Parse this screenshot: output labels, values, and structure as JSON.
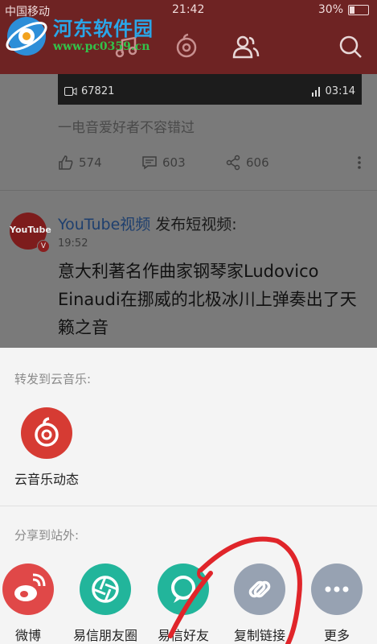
{
  "status_bar": {
    "carrier": "中国移动",
    "time": "21:42",
    "battery": "30%"
  },
  "watermark": {
    "title": "河东软件园",
    "url": "www.pc0359.cn"
  },
  "feed": {
    "video": {
      "views": "67821",
      "duration": "03:14"
    },
    "caption": "一电音爱好者不容错过",
    "actions": {
      "likes": "574",
      "comments": "603",
      "shares": "606"
    },
    "post": {
      "avatar_text": "YouTube",
      "author": "YouTube视频",
      "action_text": " 发布短视频:",
      "time": "19:52",
      "body": "意大利著名作曲家钢琴家Ludovico Einaudi在挪威的北极冰川上弹奏出了天籁之音"
    }
  },
  "share_sheet": {
    "forward_label": "转发到云音乐:",
    "forward_items": [
      {
        "label": "云音乐动态",
        "color": "#d63b33"
      }
    ],
    "external_label": "分享到站外:",
    "external_items": [
      {
        "label": "微博",
        "color": "#e04848"
      },
      {
        "label": "易信朋友圈",
        "color": "#22b59b"
      },
      {
        "label": "易信好友",
        "color": "#22b59b"
      },
      {
        "label": "复制链接",
        "color": "#97a2b2"
      },
      {
        "label": "更多",
        "color": "#97a2b2"
      }
    ]
  },
  "colors": {
    "header": "#6e2323",
    "annotation": "#e0252a"
  }
}
